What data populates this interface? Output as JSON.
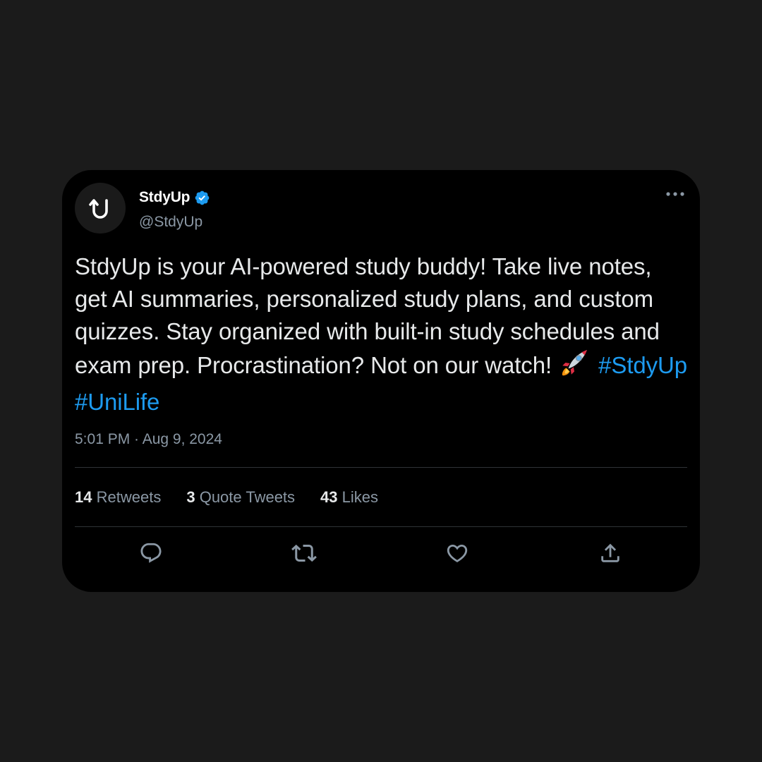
{
  "tweet": {
    "author": {
      "display_name": "StdyUp",
      "handle": "@StdyUp",
      "verified": true,
      "avatar_icon": "up-arrow-u-logo-icon"
    },
    "text": {
      "body": "StdyUp is your AI-powered study buddy! Take live notes, get AI summaries, personalized study plans, and custom quizzes. Stay organized with built-in study schedules and exam prep. Procrastination? Not on our watch!",
      "emoji": "rocket-icon",
      "hashtags": [
        "#StdyUp",
        "#UniLife"
      ]
    },
    "timestamp": "5:01 PM · Aug 9, 2024",
    "stats": [
      {
        "count": "14",
        "label": "Retweets"
      },
      {
        "count": "3",
        "label": "Quote Tweets"
      },
      {
        "count": "43",
        "label": "Likes"
      }
    ],
    "actions": [
      "reply-icon",
      "retweet-icon",
      "like-icon",
      "share-icon"
    ]
  },
  "colors": {
    "background": "#1b1b1b",
    "card": "#000000",
    "text": "#e7e9ea",
    "secondary": "#8b98a5",
    "accent": "#1d9bf0",
    "divider": "#2f3336"
  }
}
